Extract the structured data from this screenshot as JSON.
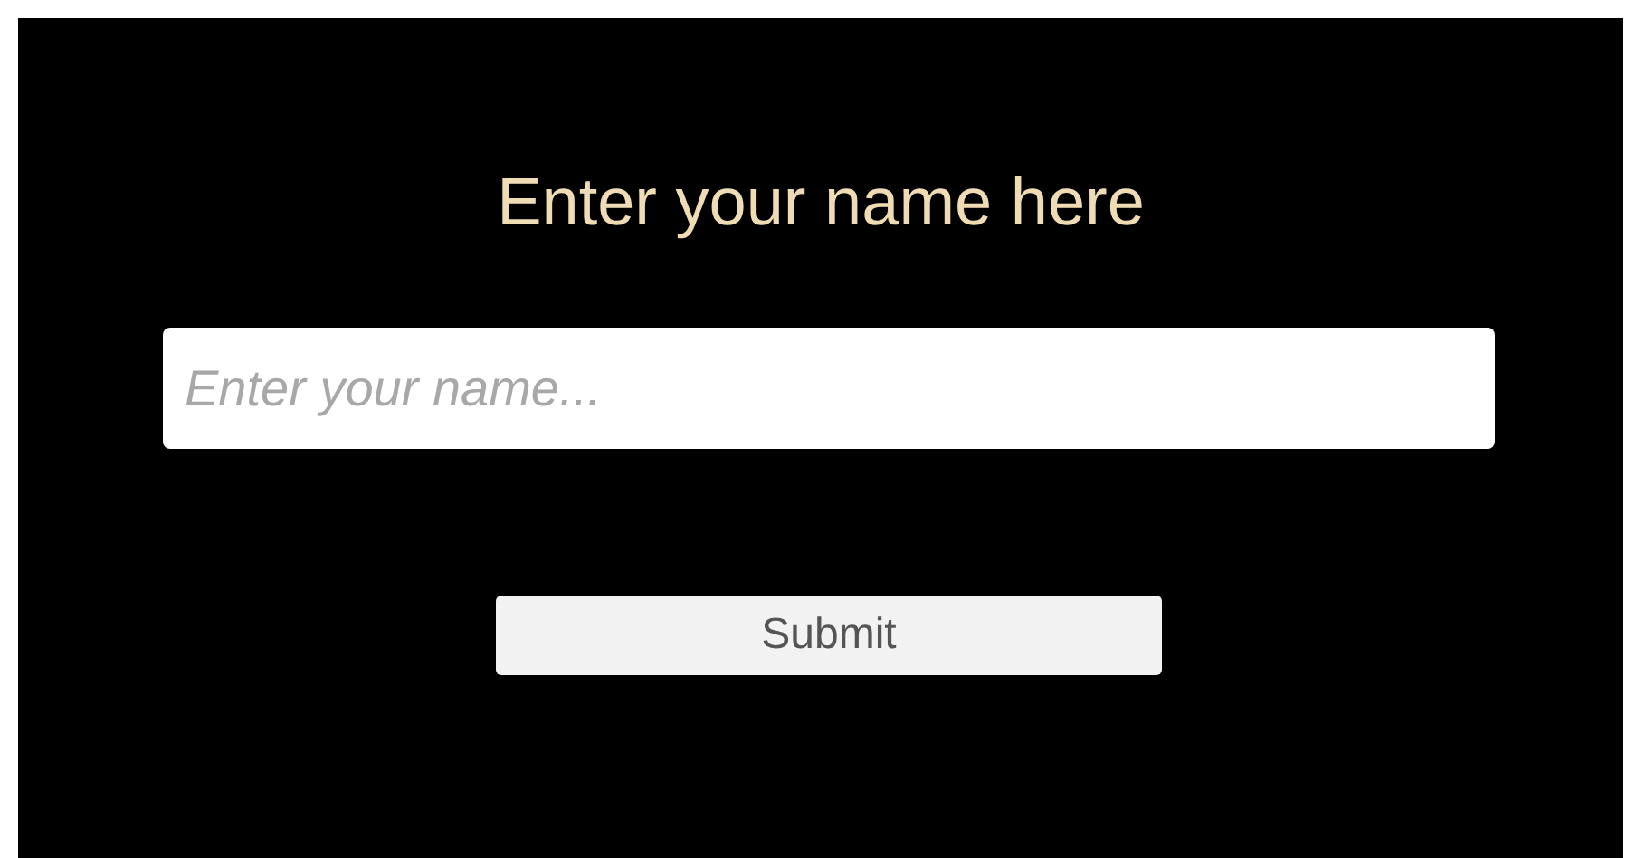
{
  "title": "Enter your name here",
  "name_field": {
    "placeholder": "Enter your name..."
  },
  "submit_button": {
    "label": "Submit"
  }
}
